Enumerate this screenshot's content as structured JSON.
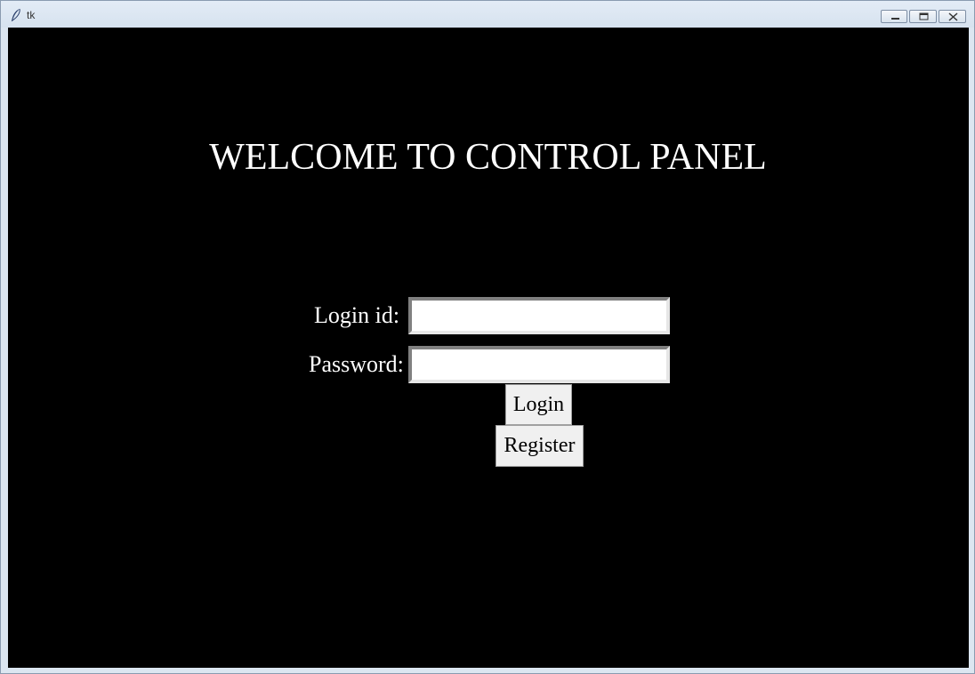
{
  "window": {
    "title": "tk",
    "icon": "feather-icon",
    "controls": [
      "minimize-icon",
      "maximize-icon",
      "close-icon"
    ]
  },
  "main": {
    "heading": "WELCOME TO CONTROL PANEL",
    "background_color": "#000000",
    "text_color": "#ffffff",
    "form": {
      "login_label": "Login id:",
      "login_value": "",
      "password_label": "Password:",
      "password_value": ""
    },
    "buttons": {
      "login_label": "Login",
      "register_label": "Register"
    }
  }
}
